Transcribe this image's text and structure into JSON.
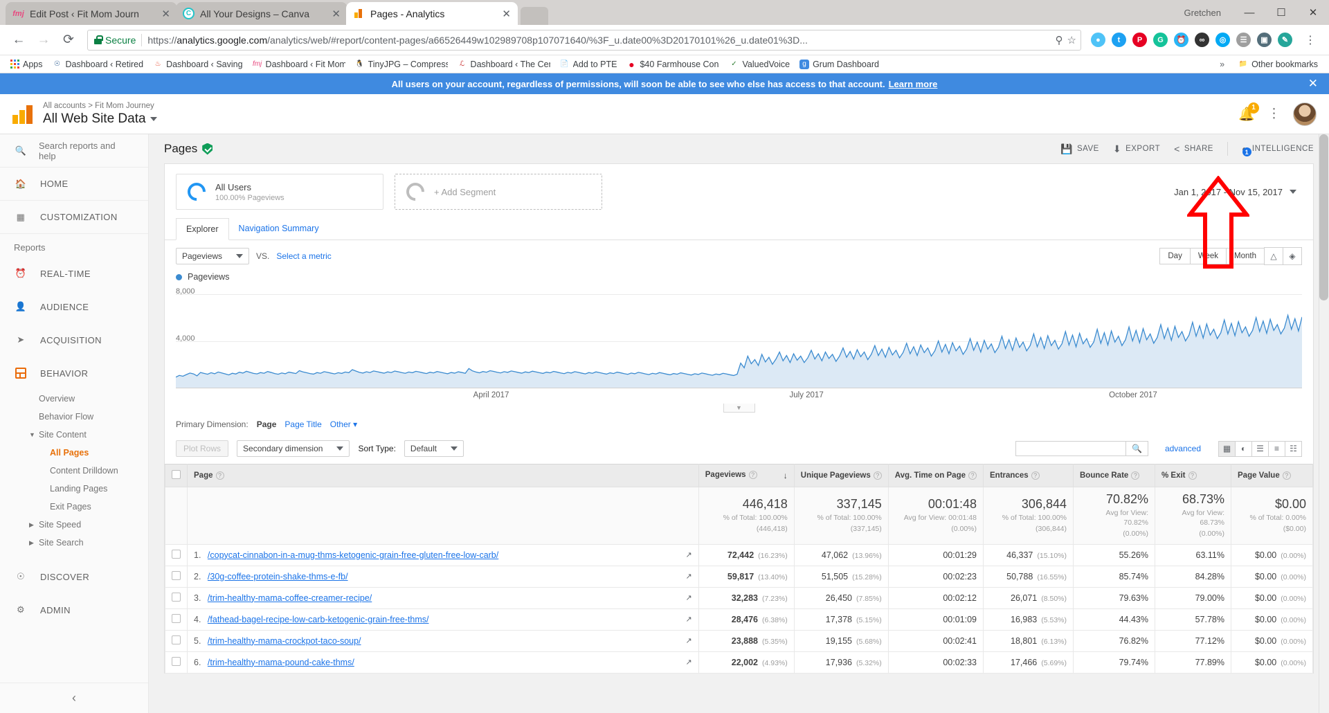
{
  "browser": {
    "tabs": [
      {
        "title": "Edit Post ‹ Fit Mom Journ",
        "favicon": "fitmomjourney-icon",
        "active": false
      },
      {
        "title": "All Your Designs – Canva",
        "favicon": "canva-icon",
        "active": false
      },
      {
        "title": "Pages - Analytics",
        "favicon": "google-analytics-icon",
        "active": true
      }
    ],
    "window": {
      "user": "Gretchen",
      "minimize": "—",
      "maximize": "☐",
      "close": "✕"
    },
    "nav": {
      "back": "←",
      "forward": "→",
      "reload": "⟳"
    },
    "omnibox": {
      "secure_label": "Secure",
      "url_prefix": "https://",
      "url_domain": "analytics.google.com",
      "url_path": "/analytics/web/#report/content-pages/a66526449w102989708p107071640/%3F_u.date00%3D20170101%26_u.date01%3D...",
      "zoom_icon": "search-icon",
      "star_icon": "star-icon"
    },
    "bookmarks": [
      {
        "label": "Apps",
        "icon": "apps-grid-icon"
      },
      {
        "label": "Dashboard ‹ Retired",
        "icon": "retired-icon"
      },
      {
        "label": "Dashboard ‹ Saving",
        "icon": "saving-icon"
      },
      {
        "label": "Dashboard ‹ Fit Mom",
        "icon": "fitmom-icon"
      },
      {
        "label": "TinyJPG – Compress",
        "icon": "tinyjpg-icon"
      },
      {
        "label": "Dashboard ‹ The Cen",
        "icon": "thecent-icon"
      },
      {
        "label": "Add to PTE",
        "icon": "page-icon"
      },
      {
        "label": "$40 Farmhouse Cons",
        "icon": "pinterest-icon"
      },
      {
        "label": "ValuedVoice",
        "icon": "valuedvoice-icon"
      },
      {
        "label": "Grum Dashboard",
        "icon": "grum-icon"
      }
    ],
    "bookmarks_overflow": "»",
    "other_bookmarks": "Other bookmarks"
  },
  "banner": {
    "text": "All users on your account, regardless of permissions, will soon be able to see who else has access to that account.",
    "link": "Learn more",
    "close": "✕"
  },
  "ga_header": {
    "breadcrumb": "All accounts > Fit Mom Journey",
    "property": "All Web Site Data",
    "notification_count": "1",
    "logo": "google-analytics-logo"
  },
  "sidebar": {
    "search_placeholder": "Search reports and help",
    "top_items": [
      {
        "label": "HOME",
        "icon": "home-icon"
      },
      {
        "label": "CUSTOMIZATION",
        "icon": "customization-icon"
      }
    ],
    "reports_label": "Reports",
    "report_items": [
      {
        "label": "REAL-TIME",
        "icon": "clock-icon"
      },
      {
        "label": "AUDIENCE",
        "icon": "person-icon"
      },
      {
        "label": "ACQUISITION",
        "icon": "acquisition-icon"
      },
      {
        "label": "BEHAVIOR",
        "icon": "behavior-icon",
        "active": true
      }
    ],
    "behavior_sub": [
      {
        "label": "Overview",
        "level": 1,
        "selected": false,
        "expander": ""
      },
      {
        "label": "Behavior Flow",
        "level": 1,
        "selected": false,
        "expander": ""
      },
      {
        "label": "Site Content",
        "level": 1,
        "selected": false,
        "expander": "▼"
      },
      {
        "label": "All Pages",
        "level": 2,
        "selected": true,
        "expander": ""
      },
      {
        "label": "Content Drilldown",
        "level": 2,
        "selected": false,
        "expander": ""
      },
      {
        "label": "Landing Pages",
        "level": 2,
        "selected": false,
        "expander": ""
      },
      {
        "label": "Exit Pages",
        "level": 2,
        "selected": false,
        "expander": ""
      },
      {
        "label": "Site Speed",
        "level": 1,
        "selected": false,
        "expander": "▶"
      },
      {
        "label": "Site Search",
        "level": 1,
        "selected": false,
        "expander": "▶"
      }
    ],
    "bottom_items": [
      {
        "label": "DISCOVER",
        "icon": "discover-icon"
      },
      {
        "label": "ADMIN",
        "icon": "gear-icon"
      }
    ],
    "collapse": "‹"
  },
  "report": {
    "title": "Pages",
    "verified_icon": "shield-check-icon",
    "toolbar": [
      {
        "label": "SAVE",
        "icon": "save-icon"
      },
      {
        "label": "EXPORT",
        "icon": "export-icon"
      },
      {
        "label": "SHARE",
        "icon": "share-icon"
      },
      {
        "label": "INTELLIGENCE",
        "icon": "intelligence-icon",
        "badge": "1"
      }
    ],
    "segments": [
      {
        "name": "All Users",
        "sub": "100.00% Pageviews"
      }
    ],
    "add_segment": "+ Add Segment",
    "date_range": "Jan 1, 2017 - Nov 15, 2017",
    "tabs": [
      {
        "label": "Explorer",
        "active": true
      },
      {
        "label": "Navigation Summary",
        "active": false
      }
    ],
    "metric_select": "Pageviews",
    "vs_label": "VS.",
    "select_metric": "Select a metric",
    "granularity": [
      {
        "label": "Day",
        "selected": false
      },
      {
        "label": "Week",
        "selected": false
      },
      {
        "label": "Month",
        "selected": false
      }
    ],
    "chart_icons": [
      {
        "icon": "line-chart-icon",
        "selected": true
      },
      {
        "icon": "scatter-chart-icon",
        "selected": false
      }
    ],
    "legend": "Pageviews",
    "primary_dimension_label": "Primary Dimension:",
    "primary_dimension_value": "Page",
    "dimension_alts": [
      {
        "label": "Page Title"
      },
      {
        "label": "Other"
      }
    ],
    "plot_rows": "Plot Rows",
    "secondary_dimension": "Secondary dimension",
    "sort_type_label": "Sort Type:",
    "sort_type_value": "Default",
    "search_value": "",
    "search_icon": "search-icon",
    "advanced": "advanced",
    "view_icons": [
      {
        "icon": "table-view-icon",
        "selected": true
      },
      {
        "icon": "pie-view-icon",
        "selected": false
      },
      {
        "icon": "bar-view-icon",
        "selected": false
      },
      {
        "icon": "performance-view-icon",
        "selected": false
      },
      {
        "icon": "pivot-view-icon",
        "selected": false
      }
    ]
  },
  "chart_data": {
    "type": "line",
    "title": "Pageviews",
    "ylabel": "",
    "xlabel": "",
    "ylim": [
      0,
      8000
    ],
    "yticks": [
      4000,
      8000
    ],
    "ytick_labels": [
      "4,000",
      "8,000"
    ],
    "xtick_labels": [
      "April 2017",
      "July 2017",
      "October 2017"
    ],
    "grid": true,
    "legend_position": "top-left",
    "series": [
      {
        "name": "Pageviews",
        "color": "#3b8bd0",
        "values": [
          900,
          1050,
          980,
          1120,
          1250,
          1180,
          1010,
          1300,
          1220,
          1150,
          1280,
          1190,
          1340,
          1260,
          1180,
          1090,
          1230,
          1170,
          1320,
          1250,
          1400,
          1310,
          1220,
          1180,
          1290,
          1230,
          1380,
          1300,
          1210,
          1150,
          1260,
          1190,
          1330,
          1270,
          1210,
          1450,
          1350,
          1280,
          1210,
          1160,
          1290,
          1230,
          1370,
          1310,
          1240,
          1180,
          1280,
          1220,
          1340,
          1280,
          1540,
          1420,
          1310,
          1250,
          1360,
          1290,
          1430,
          1370,
          1300,
          1240,
          1350,
          1290,
          1420,
          1360,
          1290,
          1230,
          1340,
          1280,
          1400,
          1340,
          1270,
          1210,
          1320,
          1260,
          1380,
          1320,
          1250,
          1190,
          1300,
          1240,
          1360,
          1300,
          1230,
          1640,
          1440,
          1340,
          1270,
          1380,
          1320,
          1450,
          1390,
          1320,
          1260,
          1370,
          1310,
          1430,
          1370,
          1300,
          1240,
          1350,
          1290,
          1410,
          1350,
          1280,
          1220,
          1330,
          1270,
          1390,
          1330,
          1260,
          1200,
          1310,
          1250,
          1370,
          1310,
          1240,
          1180,
          1290,
          1230,
          1350,
          1290,
          1220,
          1160,
          1270,
          1210,
          1330,
          1270,
          1200,
          1140,
          1250,
          1190,
          1310,
          1250,
          1180,
          1120,
          1230,
          1170,
          1290,
          1230,
          1160,
          1100,
          1210,
          1150,
          1270,
          1210,
          1140,
          1080,
          1190,
          1130,
          1250,
          1190,
          1120,
          1060,
          1170,
          1110,
          1230,
          1170,
          1100,
          1040,
          1150,
          2100,
          1700,
          2700,
          2050,
          2400,
          1900,
          2850,
          2200,
          2600,
          2000,
          2450,
          3050,
          2300,
          2750,
          2150,
          2900,
          2350,
          2700,
          2150,
          2550,
          3200,
          2450,
          2900,
          2300,
          3050,
          2500,
          2850,
          2250,
          2700,
          3400,
          2600,
          3100,
          2450,
          3250,
          2650,
          3050,
          2400,
          2850,
          3600,
          2750,
          3300,
          2600,
          3450,
          2800,
          3200,
          2550,
          3000,
          3800,
          2900,
          3500,
          2750,
          3650,
          3000,
          3400,
          2700,
          3150,
          4000,
          3050,
          3700,
          2900,
          3850,
          3150,
          3550,
          2850,
          3300,
          4200,
          3200,
          3900,
          3050,
          4050,
          3300,
          3750,
          3000,
          3450,
          4400,
          3350,
          4100,
          3200,
          4250,
          3450,
          3900,
          3150,
          3600,
          4600,
          3500,
          4300,
          3350,
          4450,
          3600,
          4050,
          3300,
          3750,
          4800,
          3650,
          4500,
          3500,
          4650,
          3750,
          4200,
          3450,
          3900,
          5000,
          3800,
          4700,
          3650,
          4850,
          3900,
          4400,
          3600,
          4100,
          5200,
          4000,
          4900,
          3850,
          5050,
          4100,
          4600,
          3800,
          4300,
          5400,
          4200,
          5100,
          4050,
          5250,
          4300,
          4800,
          4000,
          4500,
          5600,
          4400,
          5300,
          4250,
          5450,
          4500,
          5000,
          4200,
          4700,
          5800,
          4600,
          5500,
          4450,
          5650,
          4700,
          5200,
          4400,
          4900,
          6000,
          4800,
          5700,
          4650,
          5850,
          4900,
          5400,
          4600,
          5100,
          6200,
          5000,
          5900,
          4850,
          6050
        ]
      }
    ]
  },
  "table": {
    "columns": [
      {
        "label": "Page",
        "help": "?",
        "sorted": false
      },
      {
        "label": "Pageviews",
        "help": "?",
        "sorted": true,
        "sort_icon": "↓"
      },
      {
        "label": "Unique Pageviews",
        "help": "?",
        "sorted": false
      },
      {
        "label": "Avg. Time on Page",
        "help": "?",
        "sorted": false
      },
      {
        "label": "Entrances",
        "help": "?",
        "sorted": false
      },
      {
        "label": "Bounce Rate",
        "help": "?",
        "sorted": false
      },
      {
        "label": "% Exit",
        "help": "?",
        "sorted": false
      },
      {
        "label": "Page Value",
        "help": "?",
        "sorted": false
      }
    ],
    "totals": [
      {
        "main": "446,418",
        "sub1": "% of Total: 100.00%",
        "sub2": "(446,418)"
      },
      {
        "main": "337,145",
        "sub1": "% of Total: 100.00%",
        "sub2": "(337,145)"
      },
      {
        "main": "00:01:48",
        "sub1": "Avg for View: 00:01:48",
        "sub2": "(0.00%)"
      },
      {
        "main": "306,844",
        "sub1": "% of Total: 100.00%",
        "sub2": "(306,844)"
      },
      {
        "main": "70.82%",
        "sub1": "Avg for View: 70.82%",
        "sub2": "(0.00%)"
      },
      {
        "main": "68.73%",
        "sub1": "Avg for View: 68.73%",
        "sub2": "(0.00%)"
      },
      {
        "main": "$0.00",
        "sub1": "% of Total: 0.00%",
        "sub2": "($0.00)"
      }
    ],
    "rows": [
      {
        "num": "1.",
        "page": "/copycat-cinnabon-in-a-mug-thms-ketogenic-grain-free-gluten-free-low-carb/",
        "pageviews": "72,442",
        "pageviews_pct": "(16.23%)",
        "unique": "47,062",
        "unique_pct": "(13.96%)",
        "avg_time": "00:01:29",
        "entrances": "46,337",
        "entrances_pct": "(15.10%)",
        "bounce": "55.26%",
        "exit": "63.11%",
        "value": "$0.00",
        "value_pct": "(0.00%)"
      },
      {
        "num": "2.",
        "page": "/30g-coffee-protein-shake-thms-e-fb/",
        "pageviews": "59,817",
        "pageviews_pct": "(13.40%)",
        "unique": "51,505",
        "unique_pct": "(15.28%)",
        "avg_time": "00:02:23",
        "entrances": "50,788",
        "entrances_pct": "(16.55%)",
        "bounce": "85.74%",
        "exit": "84.28%",
        "value": "$0.00",
        "value_pct": "(0.00%)"
      },
      {
        "num": "3.",
        "page": "/trim-healthy-mama-coffee-creamer-recipe/",
        "pageviews": "32,283",
        "pageviews_pct": "(7.23%)",
        "unique": "26,450",
        "unique_pct": "(7.85%)",
        "avg_time": "00:02:12",
        "entrances": "26,071",
        "entrances_pct": "(8.50%)",
        "bounce": "79.63%",
        "exit": "79.00%",
        "value": "$0.00",
        "value_pct": "(0.00%)"
      },
      {
        "num": "4.",
        "page": "/fathead-bagel-recipe-low-carb-ketogenic-grain-free-thms/",
        "pageviews": "28,476",
        "pageviews_pct": "(6.38%)",
        "unique": "17,378",
        "unique_pct": "(5.15%)",
        "avg_time": "00:01:09",
        "entrances": "16,983",
        "entrances_pct": "(5.53%)",
        "bounce": "44.43%",
        "exit": "57.78%",
        "value": "$0.00",
        "value_pct": "(0.00%)"
      },
      {
        "num": "5.",
        "page": "/trim-healthy-mama-crockpot-taco-soup/",
        "pageviews": "23,888",
        "pageviews_pct": "(5.35%)",
        "unique": "19,155",
        "unique_pct": "(5.68%)",
        "avg_time": "00:02:41",
        "entrances": "18,801",
        "entrances_pct": "(6.13%)",
        "bounce": "76.82%",
        "exit": "77.12%",
        "value": "$0.00",
        "value_pct": "(0.00%)"
      },
      {
        "num": "6.",
        "page": "/trim-healthy-mama-pound-cake-thms/",
        "pageviews": "22,002",
        "pageviews_pct": "(4.93%)",
        "unique": "17,936",
        "unique_pct": "(5.32%)",
        "avg_time": "00:02:33",
        "entrances": "17,466",
        "entrances_pct": "(5.69%)",
        "bounce": "79.74%",
        "exit": "77.89%",
        "value": "$0.00",
        "value_pct": "(0.00%)"
      }
    ]
  },
  "annotation": {
    "type": "red-arrow",
    "color": "#ff0000",
    "points_to": "chart-granularity-controls"
  },
  "colors": {
    "ga_orange": "#e8710a",
    "ga_yellow": "#f9ab00",
    "link_blue": "#1a73e8",
    "banner_blue": "#3f8ae0",
    "chart_line": "#3b8bd0",
    "annotation_red": "#ff0000"
  }
}
